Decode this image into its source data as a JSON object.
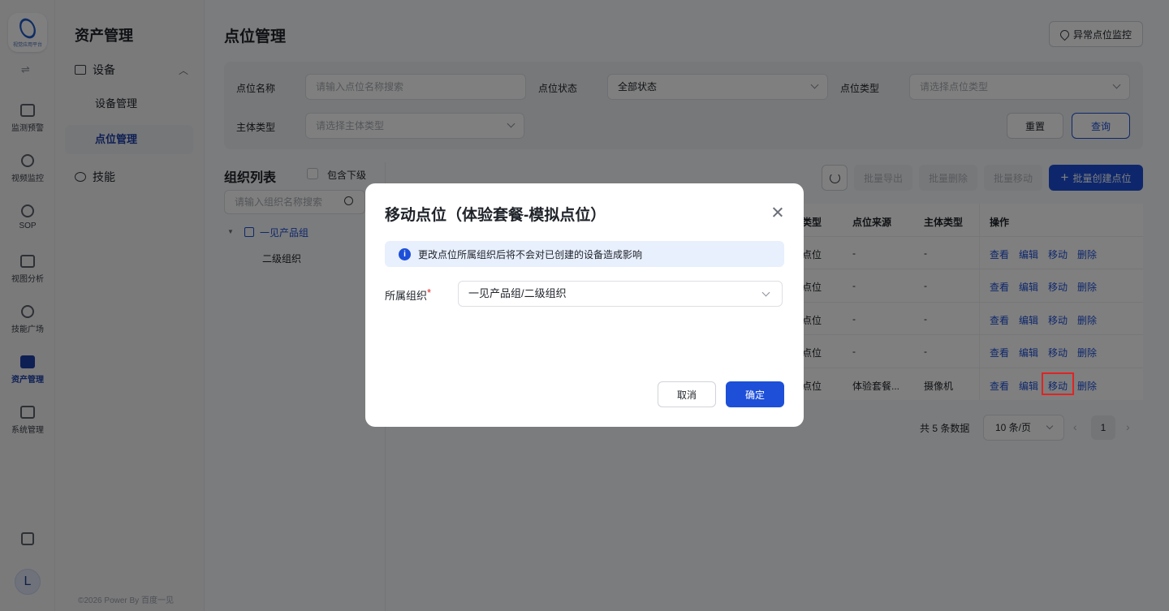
{
  "rail": {
    "logo_text": "视觉应用平台",
    "items": [
      {
        "label": "监测预警",
        "icon": "chart-icon"
      },
      {
        "label": "视频监控",
        "icon": "camera-icon"
      },
      {
        "label": "SOP",
        "icon": "sop-icon"
      },
      {
        "label": "视图分析",
        "icon": "analysis-icon"
      },
      {
        "label": "技能广场",
        "icon": "skills-icon"
      },
      {
        "label": "资产管理",
        "icon": "asset-icon",
        "active": true
      },
      {
        "label": "系统管理",
        "icon": "system-icon"
      }
    ],
    "avatar": "L"
  },
  "sidebar": {
    "title": "资产管理",
    "group_device": "设备",
    "items": [
      {
        "label": "设备管理"
      },
      {
        "label": "点位管理",
        "active": true
      }
    ],
    "group_skill": "技能",
    "copyright": "©2026 Power By 百度一见"
  },
  "page": {
    "title": "点位管理",
    "abnormal_button": "异常点位监控"
  },
  "filters": {
    "name_label": "点位名称",
    "name_placeholder": "请输入点位名称搜索",
    "status_label": "点位状态",
    "status_value": "全部状态",
    "type_label": "点位类型",
    "type_placeholder": "请选择点位类型",
    "subject_label": "主体类型",
    "subject_placeholder": "请选择主体类型",
    "reset": "重置",
    "query": "查询"
  },
  "org": {
    "title": "组织列表",
    "include_sub": "包含下级",
    "search_placeholder": "请输入组织名称搜索",
    "root": "一见产品组",
    "child": "二级组织"
  },
  "toolbar": {
    "export": "批量导出",
    "delete": "批量删除",
    "move": "批量移动",
    "create": "批量创建点位",
    "create_plus": "+"
  },
  "table": {
    "columns": [
      "类型",
      "点位来源",
      "主体类型",
      "操作"
    ],
    "rows": [
      [
        "点位",
        "-",
        "-"
      ],
      [
        "点位",
        "-",
        "-"
      ],
      [
        "点位",
        "-",
        "-"
      ],
      [
        "点位",
        "-",
        "-"
      ],
      [
        "点位",
        "体验套餐...",
        "摄像机"
      ]
    ],
    "actions": [
      "查看",
      "编辑",
      "移动",
      "删除"
    ]
  },
  "pagination": {
    "total": "共 5 条数据",
    "page_size": "10 条/页",
    "current": "1",
    "prev": "‹",
    "next": "›"
  },
  "modal": {
    "title": "移动点位（体验套餐-模拟点位）",
    "info": "更改点位所属组织后将不会对已创建的设备造成影响",
    "info_icon": "i",
    "org_label": "所属组织",
    "required": "*",
    "org_value": "一见产品组/二级组织",
    "cancel": "取消",
    "confirm": "确定"
  },
  "colors": {
    "primary": "#1d4fd8",
    "highlight": "#e02424"
  }
}
